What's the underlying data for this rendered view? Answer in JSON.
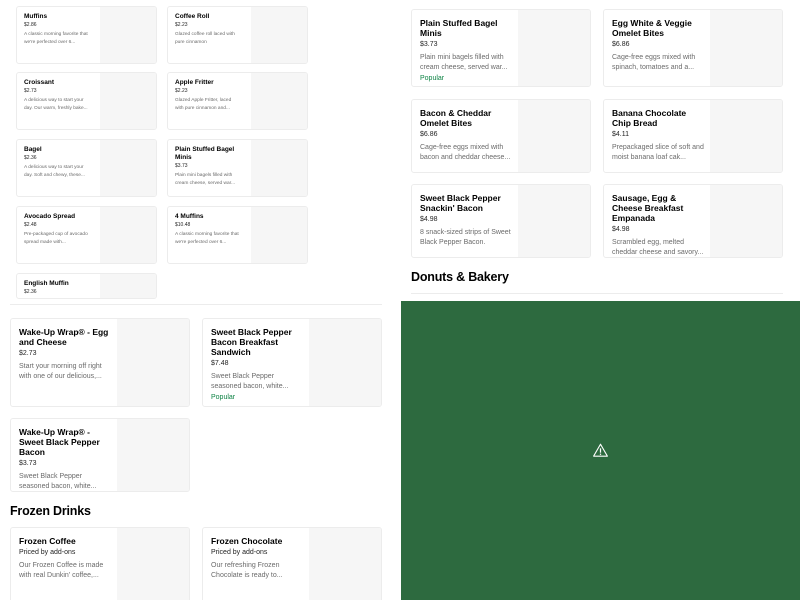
{
  "small_cards": [
    {
      "name": "Muffins",
      "price": "$2.86",
      "desc": "A classic morning favorite that we're perfected over 6..."
    },
    {
      "name": "Coffee Roll",
      "price": "$2.23",
      "desc": "Glazed coffee roll laced with pure cinnamon"
    },
    {
      "name": "Croissant",
      "price": "$2.73",
      "desc": "A delicious way to start your day. Our warm, freshly bake..."
    },
    {
      "name": "Apple Fritter",
      "price": "$2.23",
      "desc": "Glazed Apple Fritter, laced with pure cinnamon and..."
    },
    {
      "name": "Bagel",
      "price": "$2.36",
      "desc": "A delicious way to start your day. Soft and chewy, these..."
    },
    {
      "name": "Plain Stuffed Bagel Minis",
      "price": "$3.73",
      "desc": "Plain mini bagels filled with cream cheese, served war..."
    },
    {
      "name": "Avocado Spread",
      "price": "$2.48",
      "desc": "Pre-packaged cup of avocado spread made with..."
    },
    {
      "name": "4 Muffins",
      "price": "$10.48",
      "desc": "A classic morning favorite that we're perfected over 6..."
    },
    {
      "name": "English Muffin",
      "price": "$2.36",
      "desc": ""
    }
  ],
  "medium_cards": [
    {
      "name": "Wake-Up Wrap® - Egg and Cheese",
      "price": "$2.73",
      "desc": "Start your morning off right with one of our delicious,...",
      "badge": ""
    },
    {
      "name": "Sweet Black Pepper Bacon Breakfast Sandwich",
      "price": "$7.48",
      "desc": "Sweet Black Pepper seasoned bacon, white...",
      "badge": "Popular"
    },
    {
      "name": "Wake-Up Wrap® - Sweet Black Pepper Bacon",
      "price": "$3.73",
      "desc": "Sweet Black Pepper seasoned bacon, white...",
      "badge": ""
    }
  ],
  "sections": {
    "frozen_drinks": "Frozen Drinks",
    "donuts_bakery": "Donuts & Bakery"
  },
  "frozen_cards": [
    {
      "name": "Frozen Coffee",
      "price": "Priced by add-ons",
      "desc": "Our Frozen Coffee is made with real Dunkin' coffee,..."
    },
    {
      "name": "Frozen Chocolate",
      "price": "Priced by add-ons",
      "desc": "Our refreshing Frozen Chocolate is ready to..."
    }
  ],
  "right_cards": [
    {
      "name": "Plain Stuffed Bagel Minis",
      "price": "$3.73",
      "desc": "Plain mini bagels filled with cream cheese, served war...",
      "badge": "Popular"
    },
    {
      "name": "Egg White & Veggie Omelet Bites",
      "price": "$6.86",
      "desc": "Cage-free eggs mixed with spinach, tomatoes and a...",
      "badge": ""
    },
    {
      "name": "Bacon & Cheddar Omelet Bites",
      "price": "$6.86",
      "desc": "Cage-free eggs mixed with bacon and cheddar cheese...",
      "badge": ""
    },
    {
      "name": "Banana Chocolate Chip Bread",
      "price": "$4.11",
      "desc": "Prepackaged slice of soft and moist banana loaf cak...",
      "badge": ""
    },
    {
      "name": "Sweet Black Pepper Snackin' Bacon",
      "price": "$4.98",
      "desc": "8 snack-sized strips of Sweet Black Pepper Bacon.",
      "badge": ""
    },
    {
      "name": "Sausage, Egg & Cheese Breakfast Empanada",
      "price": "$4.98",
      "desc": "Scrambled egg, melted cheddar cheese and savory...",
      "badge": ""
    }
  ],
  "overlay": {
    "color": "#2d6a3f",
    "icon": "warning-icon"
  }
}
